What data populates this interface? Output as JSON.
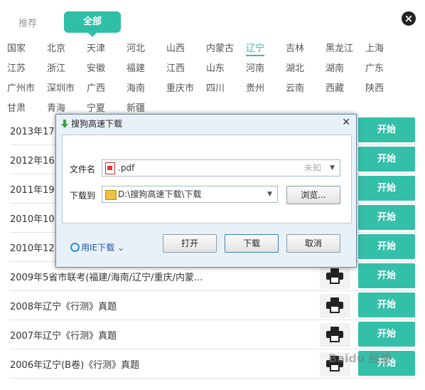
{
  "tabs": {
    "recommended": "推荐",
    "all": "全部"
  },
  "regions": [
    [
      "国家",
      "北京",
      "天津",
      "河北",
      "山西",
      "内蒙古",
      "辽宁",
      "吉林",
      "黑龙江",
      "上海"
    ],
    [
      "江苏",
      "浙江",
      "安徽",
      "福建",
      "江西",
      "山东",
      "河南",
      "湖北",
      "湖南",
      "广东"
    ],
    [
      "广州市",
      "深圳市",
      "广西",
      "海南",
      "重庆市",
      "四川",
      "贵州",
      "云南",
      "西藏",
      "陕西"
    ],
    [
      "甘肃",
      "青海",
      "宁夏",
      "新疆"
    ]
  ],
  "active_region": "辽宁",
  "rows": [
    {
      "title": "2013年17..."
    },
    {
      "title": "2012年16..."
    },
    {
      "title": "2011年19..."
    },
    {
      "title": "2010年10..."
    },
    {
      "title": "2010年12..."
    },
    {
      "title": "2009年5省市联考(福建/海南/辽宁/重庆/内蒙..."
    },
    {
      "title": "2008年辽宁《行测》真题"
    },
    {
      "title": "2007年辽宁《行测》真题"
    },
    {
      "title": "2006年辽宁(B卷)《行测》真题"
    }
  ],
  "start_label": "开始",
  "dialog": {
    "title": "搜狗高速下载",
    "close": "✕",
    "filename_label": "文件名",
    "filename": ".pdf",
    "size": "未知",
    "saveto_label": "下载到",
    "saveto": "D:\\搜狗高速下载\\下载",
    "browse": "浏览...",
    "ie_download": "用IE下载",
    "open": "打开",
    "download": "下载",
    "cancel": "取消"
  },
  "watermark": "Baidu 经验"
}
